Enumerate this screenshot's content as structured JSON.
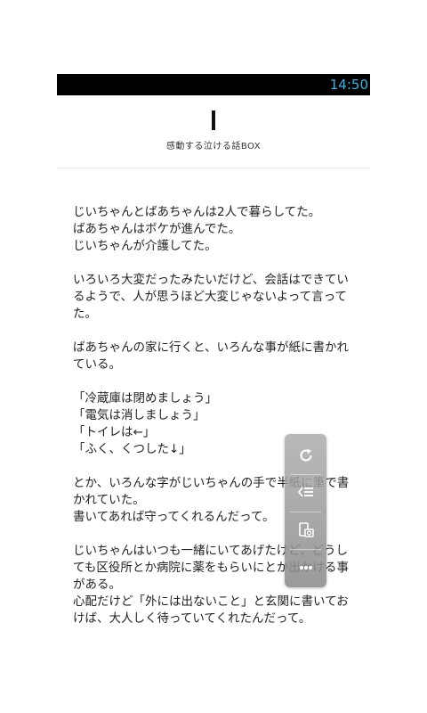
{
  "status_bar": {
    "time": "14:50"
  },
  "header": {
    "site_name": "感動する泣ける話BOX"
  },
  "article": {
    "paragraphs": [
      "じいちゃんとばあちゃんは2人で暮らしてた。\nばあちゃんはボケが進んでた。\nじいちゃんが介護してた。",
      "いろいろ大変だったみたいだけど、会話はできているようで、人が思うほど大変じゃないよって言ってた。",
      "ばあちゃんの家に行くと、いろんな事が紙に書かれている。",
      "「冷蔵庫は閉めましょう」\n「電気は消しましょう」\n「トイレは←」\n「ふく、くつした↓」",
      "とか、いろんな字がじいちゃんの手で半紙に筆で書かれていた。\n書いてあれば守ってくれるんだって。",
      "じいちゃんはいつも一緒にいてあげたけど、どうしても区役所とか病院に薬をもらいにとか出かける事がある。\n心配だけど「外には出ないこと」と玄関に書いておけば、大人しく待っていてくれたんだって。"
    ]
  },
  "float_panel": {
    "icons": [
      "refresh-icon",
      "contents-list-icon",
      "screenshot-icon",
      "more-icon"
    ]
  },
  "colors": {
    "status_time": "#33b5e5",
    "status_bar_bg": "#000000",
    "text": "#222222"
  }
}
